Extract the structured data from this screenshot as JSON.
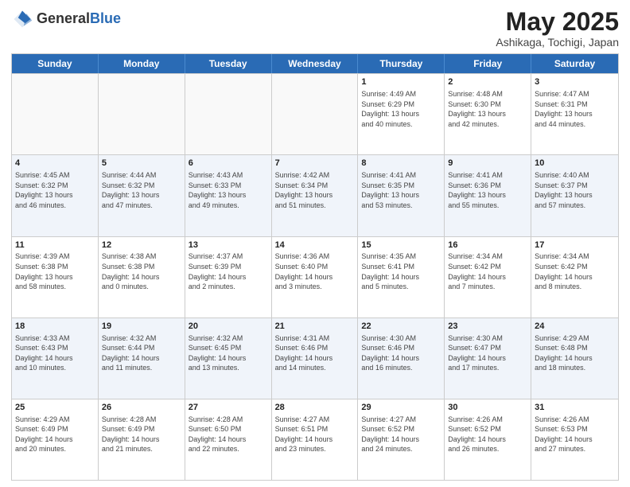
{
  "logo": {
    "general": "General",
    "blue": "Blue"
  },
  "header": {
    "title": "May 2025",
    "subtitle": "Ashikaga, Tochigi, Japan"
  },
  "days": [
    "Sunday",
    "Monday",
    "Tuesday",
    "Wednesday",
    "Thursday",
    "Friday",
    "Saturday"
  ],
  "weeks": [
    [
      {
        "day": "",
        "info": ""
      },
      {
        "day": "",
        "info": ""
      },
      {
        "day": "",
        "info": ""
      },
      {
        "day": "",
        "info": ""
      },
      {
        "day": "1",
        "info": "Sunrise: 4:49 AM\nSunset: 6:29 PM\nDaylight: 13 hours\nand 40 minutes."
      },
      {
        "day": "2",
        "info": "Sunrise: 4:48 AM\nSunset: 6:30 PM\nDaylight: 13 hours\nand 42 minutes."
      },
      {
        "day": "3",
        "info": "Sunrise: 4:47 AM\nSunset: 6:31 PM\nDaylight: 13 hours\nand 44 minutes."
      }
    ],
    [
      {
        "day": "4",
        "info": "Sunrise: 4:45 AM\nSunset: 6:32 PM\nDaylight: 13 hours\nand 46 minutes."
      },
      {
        "day": "5",
        "info": "Sunrise: 4:44 AM\nSunset: 6:32 PM\nDaylight: 13 hours\nand 47 minutes."
      },
      {
        "day": "6",
        "info": "Sunrise: 4:43 AM\nSunset: 6:33 PM\nDaylight: 13 hours\nand 49 minutes."
      },
      {
        "day": "7",
        "info": "Sunrise: 4:42 AM\nSunset: 6:34 PM\nDaylight: 13 hours\nand 51 minutes."
      },
      {
        "day": "8",
        "info": "Sunrise: 4:41 AM\nSunset: 6:35 PM\nDaylight: 13 hours\nand 53 minutes."
      },
      {
        "day": "9",
        "info": "Sunrise: 4:41 AM\nSunset: 6:36 PM\nDaylight: 13 hours\nand 55 minutes."
      },
      {
        "day": "10",
        "info": "Sunrise: 4:40 AM\nSunset: 6:37 PM\nDaylight: 13 hours\nand 57 minutes."
      }
    ],
    [
      {
        "day": "11",
        "info": "Sunrise: 4:39 AM\nSunset: 6:38 PM\nDaylight: 13 hours\nand 58 minutes."
      },
      {
        "day": "12",
        "info": "Sunrise: 4:38 AM\nSunset: 6:38 PM\nDaylight: 14 hours\nand 0 minutes."
      },
      {
        "day": "13",
        "info": "Sunrise: 4:37 AM\nSunset: 6:39 PM\nDaylight: 14 hours\nand 2 minutes."
      },
      {
        "day": "14",
        "info": "Sunrise: 4:36 AM\nSunset: 6:40 PM\nDaylight: 14 hours\nand 3 minutes."
      },
      {
        "day": "15",
        "info": "Sunrise: 4:35 AM\nSunset: 6:41 PM\nDaylight: 14 hours\nand 5 minutes."
      },
      {
        "day": "16",
        "info": "Sunrise: 4:34 AM\nSunset: 6:42 PM\nDaylight: 14 hours\nand 7 minutes."
      },
      {
        "day": "17",
        "info": "Sunrise: 4:34 AM\nSunset: 6:42 PM\nDaylight: 14 hours\nand 8 minutes."
      }
    ],
    [
      {
        "day": "18",
        "info": "Sunrise: 4:33 AM\nSunset: 6:43 PM\nDaylight: 14 hours\nand 10 minutes."
      },
      {
        "day": "19",
        "info": "Sunrise: 4:32 AM\nSunset: 6:44 PM\nDaylight: 14 hours\nand 11 minutes."
      },
      {
        "day": "20",
        "info": "Sunrise: 4:32 AM\nSunset: 6:45 PM\nDaylight: 14 hours\nand 13 minutes."
      },
      {
        "day": "21",
        "info": "Sunrise: 4:31 AM\nSunset: 6:46 PM\nDaylight: 14 hours\nand 14 minutes."
      },
      {
        "day": "22",
        "info": "Sunrise: 4:30 AM\nSunset: 6:46 PM\nDaylight: 14 hours\nand 16 minutes."
      },
      {
        "day": "23",
        "info": "Sunrise: 4:30 AM\nSunset: 6:47 PM\nDaylight: 14 hours\nand 17 minutes."
      },
      {
        "day": "24",
        "info": "Sunrise: 4:29 AM\nSunset: 6:48 PM\nDaylight: 14 hours\nand 18 minutes."
      }
    ],
    [
      {
        "day": "25",
        "info": "Sunrise: 4:29 AM\nSunset: 6:49 PM\nDaylight: 14 hours\nand 20 minutes."
      },
      {
        "day": "26",
        "info": "Sunrise: 4:28 AM\nSunset: 6:49 PM\nDaylight: 14 hours\nand 21 minutes."
      },
      {
        "day": "27",
        "info": "Sunrise: 4:28 AM\nSunset: 6:50 PM\nDaylight: 14 hours\nand 22 minutes."
      },
      {
        "day": "28",
        "info": "Sunrise: 4:27 AM\nSunset: 6:51 PM\nDaylight: 14 hours\nand 23 minutes."
      },
      {
        "day": "29",
        "info": "Sunrise: 4:27 AM\nSunset: 6:52 PM\nDaylight: 14 hours\nand 24 minutes."
      },
      {
        "day": "30",
        "info": "Sunrise: 4:26 AM\nSunset: 6:52 PM\nDaylight: 14 hours\nand 26 minutes."
      },
      {
        "day": "31",
        "info": "Sunrise: 4:26 AM\nSunset: 6:53 PM\nDaylight: 14 hours\nand 27 minutes."
      }
    ]
  ]
}
